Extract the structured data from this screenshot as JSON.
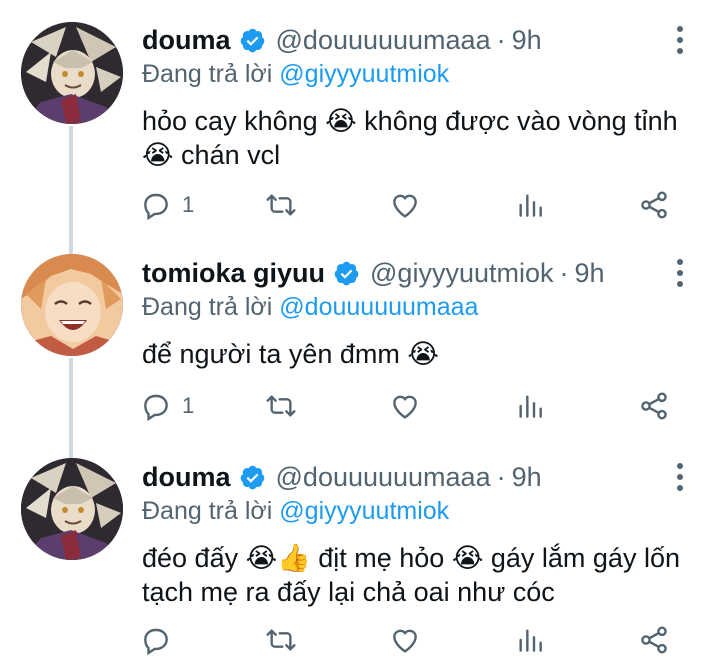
{
  "tweets": [
    {
      "name": "douma",
      "handle": "@douuuuuumaaa",
      "separator": "·",
      "time": "9h",
      "reply_prefix": "Đang trả lời",
      "reply_to": "@giyyyuutmiok",
      "text_line1": "hỏo cay không 😭 không được vào vòng tỉnh",
      "text_line2": "😭 chán vcl",
      "reply_count": "1",
      "avatar": "douma-avatar"
    },
    {
      "name": "tomioka giyuu",
      "handle": "@giyyyuutmiok",
      "separator": "·",
      "time": "9h",
      "reply_prefix": "Đang trả lời",
      "reply_to": "@douuuuuumaaa",
      "text_line1": "để người ta yên đmm 😭",
      "reply_count": "1",
      "avatar": "giyuu-avatar"
    },
    {
      "name": "douma",
      "handle": "@douuuuuumaaa",
      "separator": "·",
      "time": "9h",
      "reply_prefix": "Đang trả lời",
      "reply_to": "@giyyyuutmiok",
      "text_line1": "đéo đấy 😭👍 địt mẹ hỏo 😭 gáy lắm gáy lốn",
      "text_line2": "tạch mẹ ra đấy lại chả oai như cóc",
      "reply_count": "",
      "avatar": "douma-avatar"
    }
  ],
  "icons": {
    "reply": "reply-icon",
    "retweet": "retweet-icon",
    "like": "heart-icon",
    "analytics": "analytics-icon",
    "share": "share-icon",
    "more": "more-vertical-icon",
    "verified": "verified-badge-icon"
  },
  "colors": {
    "accent": "#1d9bf0",
    "secondary_text": "#536471",
    "primary_text": "#0f1419",
    "thread_line": "#cfd9de"
  }
}
